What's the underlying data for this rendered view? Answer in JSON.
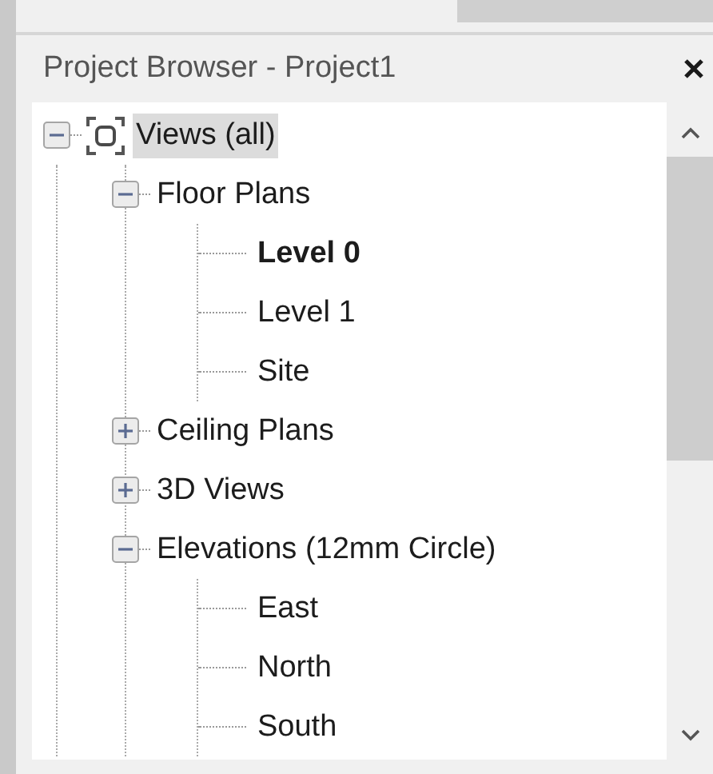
{
  "panel": {
    "title": "Project Browser - Project1"
  },
  "tree": [
    {
      "label": "Views (all)",
      "expanded": true,
      "selected": true,
      "children": [
        {
          "label": "Floor Plans",
          "expanded": true,
          "selected": false,
          "children": [
            {
              "label": "Level 0",
              "active": true,
              "selected": false
            },
            {
              "label": "Level 1",
              "active": false,
              "selected": false
            },
            {
              "label": "Site",
              "active": false,
              "selected": false
            }
          ]
        },
        {
          "label": "Ceiling Plans",
          "expanded": false,
          "selected": false
        },
        {
          "label": "3D Views",
          "expanded": false,
          "selected": false
        },
        {
          "label": "Elevations (12mm Circle)",
          "expanded": true,
          "selected": false,
          "children": [
            {
              "label": "East",
              "active": false,
              "selected": false
            },
            {
              "label": "North",
              "active": false,
              "selected": false
            },
            {
              "label": "South",
              "active": false,
              "selected": false
            }
          ]
        }
      ]
    }
  ]
}
